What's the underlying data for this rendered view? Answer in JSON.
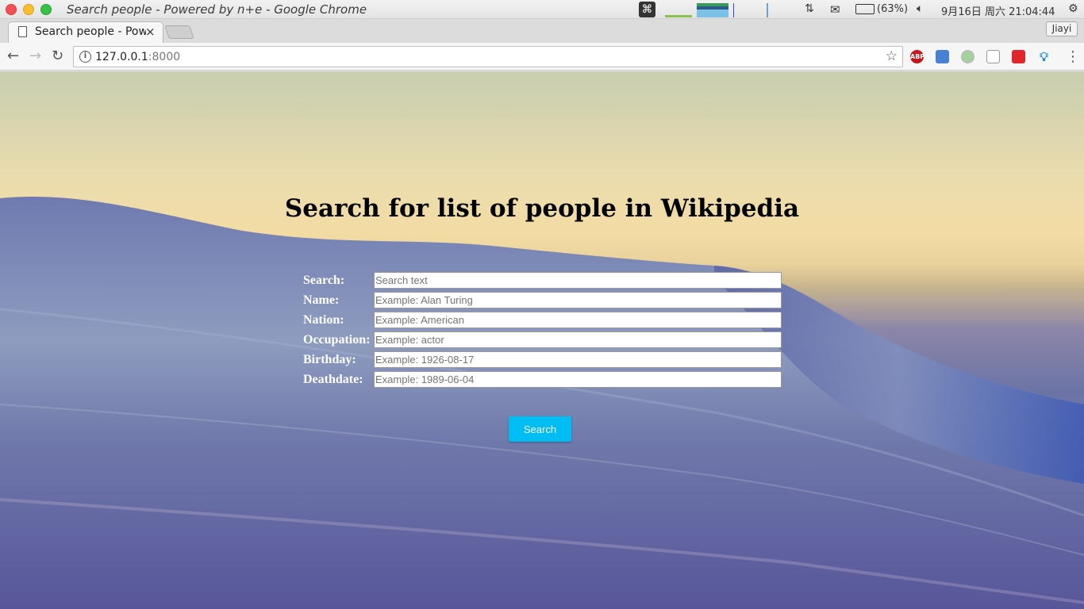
{
  "system_bar": {
    "window_title": "Search people - Powered by n+e - Google Chrome",
    "battery": "(63%)",
    "datetime": "9月16日 周六 21:04:44"
  },
  "tab": {
    "title": "Search people - Powered by n+e",
    "close_label": "×"
  },
  "profile": {
    "name": "Jiayi"
  },
  "address_bar": {
    "host": "127.0.0.1",
    "port": ":8000"
  },
  "extensions": {
    "abp_label": "ABP"
  },
  "page": {
    "heading": "Search for list of people in Wikipedia",
    "fields": [
      {
        "label": "Search:",
        "placeholder": "Search text"
      },
      {
        "label": "Name:",
        "placeholder": "Example: Alan Turing"
      },
      {
        "label": "Nation:",
        "placeholder": "Example: American"
      },
      {
        "label": "Occupation:",
        "placeholder": "Example: actor"
      },
      {
        "label": "Birthday:",
        "placeholder": "Example: 1926-08-17"
      },
      {
        "label": "Deathdate:",
        "placeholder": "Example: 1989-06-04"
      }
    ],
    "submit_label": "Search"
  },
  "colors": {
    "button": "#00bdf4",
    "sky": "#f3dca4",
    "wave": "#6b73a6"
  }
}
